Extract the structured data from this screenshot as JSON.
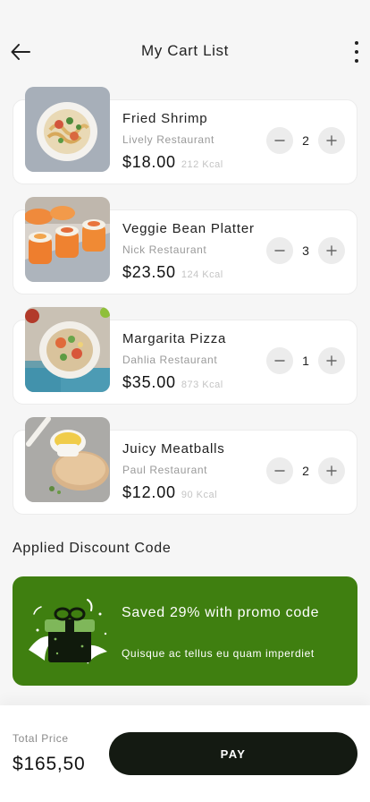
{
  "header": {
    "title": "My Cart List",
    "back_icon": "arrow-left-icon",
    "more_icon": "more-vertical-icon"
  },
  "cart": {
    "items": [
      {
        "name": "Fried Shrimp",
        "restaurant": "Lively Restaurant",
        "price": "$18.00",
        "kcal": "212 Kcal",
        "quantity": "2",
        "image": "pasta-with-shrimp"
      },
      {
        "name": "Veggie Bean Platter",
        "restaurant": "Nick Restaurant",
        "price": "$23.50",
        "kcal": "124 Kcal",
        "quantity": "3",
        "image": "sushi-rolls"
      },
      {
        "name": "Margarita Pizza",
        "restaurant": "Dahlia Restaurant",
        "price": "$35.00",
        "kcal": "873 Kcal",
        "quantity": "1",
        "image": "salad-bowl"
      },
      {
        "name": "Juicy Meatballs",
        "restaurant": "Paul Restaurant",
        "price": "$12.00",
        "kcal": "90 Kcal",
        "quantity": "2",
        "image": "soup-cup-on-board"
      }
    ],
    "minus_icon": "minus-icon",
    "plus_icon": "plus-icon"
  },
  "discount": {
    "heading": "Applied Discount Code",
    "title": "Saved 29% with promo code",
    "subtitle": "Quisque ac tellus eu quam imperdiet",
    "art_icon": "gift-box-icon",
    "bg_color": "#3f7f10"
  },
  "footer": {
    "total_label": "Total Price",
    "total_value": "$165,50",
    "pay_label": "PAY",
    "pay_color": "#141a12"
  }
}
